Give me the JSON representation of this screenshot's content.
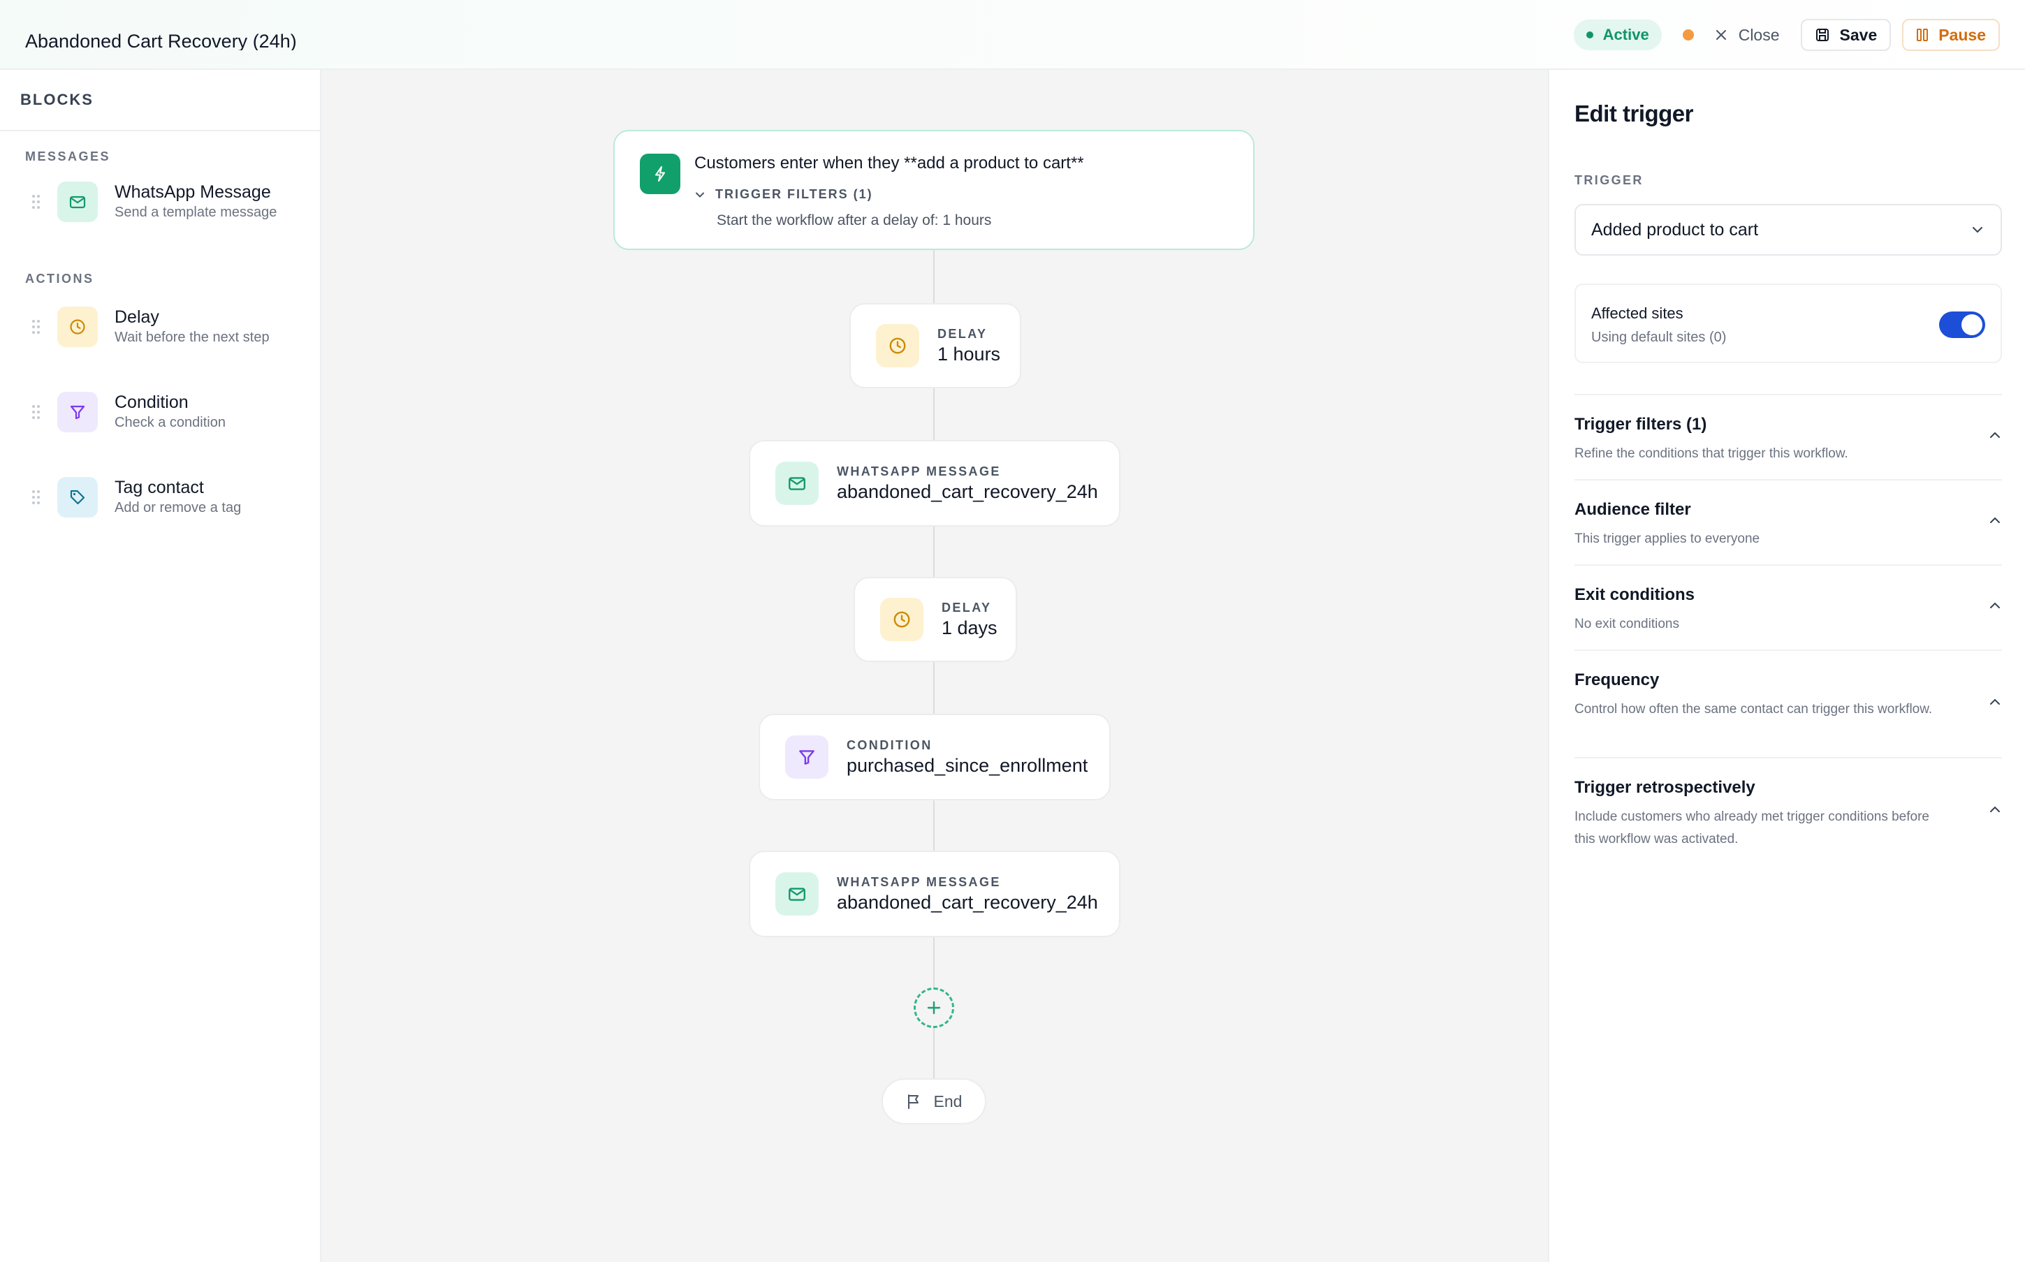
{
  "header": {
    "title": "Abandoned Cart Recovery (24h)",
    "status": "Active",
    "close_label": "Close",
    "save_label": "Save",
    "pause_label": "Pause"
  },
  "sidebar": {
    "title": "BLOCKS",
    "sections": [
      {
        "label": "MESSAGES",
        "items": [
          {
            "name": "WhatsApp Message",
            "desc": "Send a template message",
            "icon": "mail-icon"
          }
        ]
      },
      {
        "label": "ACTIONS",
        "items": [
          {
            "name": "Delay",
            "desc": "Wait before the next step",
            "icon": "clock-icon"
          },
          {
            "name": "Condition",
            "desc": "Check a condition",
            "icon": "filter-icon"
          },
          {
            "name": "Tag contact",
            "desc": "Add or remove a tag",
            "icon": "tag-icon"
          }
        ]
      }
    ]
  },
  "canvas": {
    "trigger": {
      "title": "Customers enter when they **add a product to cart**",
      "filters_label": "TRIGGER FILTERS (1)",
      "delay_text": "Start the workflow after a delay of: 1 hours"
    },
    "nodes": [
      {
        "label": "DELAY",
        "value": "1 hours"
      },
      {
        "label": "WHATSAPP MESSAGE",
        "value": "abandoned_cart_recovery_24h"
      },
      {
        "label": "DELAY",
        "value": "1 days"
      },
      {
        "label": "CONDITION",
        "value": "purchased_since_enrollment"
      },
      {
        "label": "WHATSAPP MESSAGE",
        "value": "abandoned_cart_recovery_24h"
      }
    ],
    "end_label": "End"
  },
  "panel": {
    "title": "Edit trigger",
    "trigger_label": "TRIGGER",
    "trigger_value": "Added product to cart",
    "affected_sites": {
      "title": "Affected sites",
      "subtitle": "Using default sites (0)",
      "enabled": true
    },
    "sections": [
      {
        "title": "Trigger filters (1)",
        "desc": "Refine the conditions that trigger this workflow."
      },
      {
        "title": "Audience filter",
        "desc": "This trigger applies to everyone"
      },
      {
        "title": "Exit conditions",
        "desc": "No exit conditions"
      },
      {
        "title": "Frequency",
        "desc": "Control how often the same contact can trigger this workflow."
      },
      {
        "title": "Trigger retrospectively",
        "desc": "Include customers who already met trigger conditions before this workflow was activated."
      }
    ]
  },
  "colors": {
    "accent_green": "#11a06c",
    "toggle_blue": "#1d4ed8",
    "pause_orange": "#d26d0d"
  }
}
